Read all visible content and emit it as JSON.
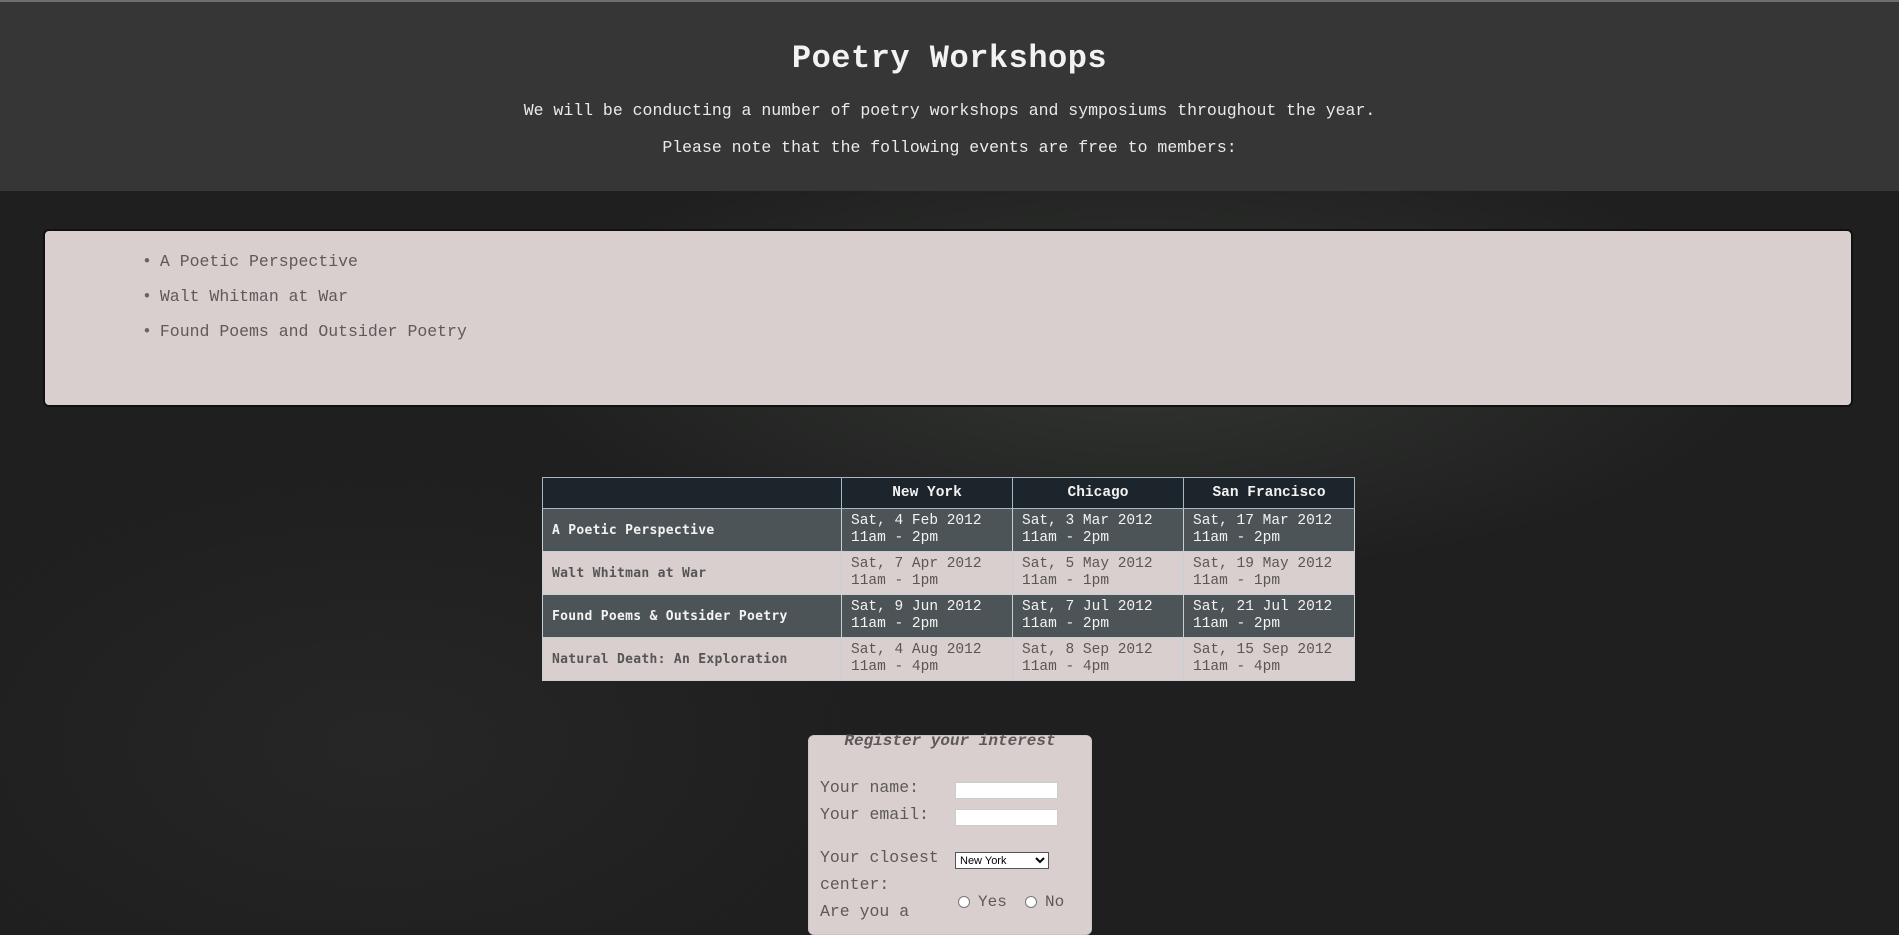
{
  "header": {
    "title": "Poetry Workshops",
    "intro": "We will be conducting a number of poetry workshops and symposiums throughout the year.",
    "note": "Please note that the following events are free to members:"
  },
  "free_events": [
    "A Poetic Perspective",
    "Walt Whitman at War",
    "Found Poems and Outsider Poetry"
  ],
  "schedule": {
    "columns": [
      "",
      "New York",
      "Chicago",
      "San Francisco"
    ],
    "rows": [
      {
        "title": "A Poetic Perspective",
        "style": "dark",
        "cells": [
          [
            "Sat, 4 Feb 2012",
            "11am - 2pm"
          ],
          [
            "Sat, 3 Mar 2012",
            "11am - 2pm"
          ],
          [
            "Sat, 17 Mar 2012",
            "11am - 2pm"
          ]
        ]
      },
      {
        "title": "Walt Whitman at War",
        "style": "light",
        "cells": [
          [
            "Sat, 7 Apr 2012",
            "11am - 1pm"
          ],
          [
            "Sat, 5 May 2012",
            "11am - 1pm"
          ],
          [
            "Sat, 19 May 2012",
            "11am - 1pm"
          ]
        ]
      },
      {
        "title": "Found Poems & Outsider Poetry",
        "style": "dark",
        "cells": [
          [
            "Sat, 9 Jun 2012",
            "11am - 2pm"
          ],
          [
            "Sat, 7 Jul 2012",
            "11am - 2pm"
          ],
          [
            "Sat, 21 Jul 2012",
            "11am - 2pm"
          ]
        ]
      },
      {
        "title": "Natural Death: An Exploration",
        "style": "light",
        "cells": [
          [
            "Sat, 4 Aug 2012",
            "11am - 4pm"
          ],
          [
            "Sat, 8 Sep 2012",
            "11am - 4pm"
          ],
          [
            "Sat, 15 Sep 2012",
            "11am - 4pm"
          ]
        ]
      }
    ]
  },
  "register": {
    "legend": "Register your interest",
    "name_label": "Your name:",
    "name_value": "",
    "email_label": "Your email:",
    "email_value": "",
    "center_label_1": "Your closest",
    "center_label_2": "center:",
    "center_selected": "New York",
    "member_label": "Are you a",
    "yes_label": "Yes",
    "no_label": "No"
  }
}
